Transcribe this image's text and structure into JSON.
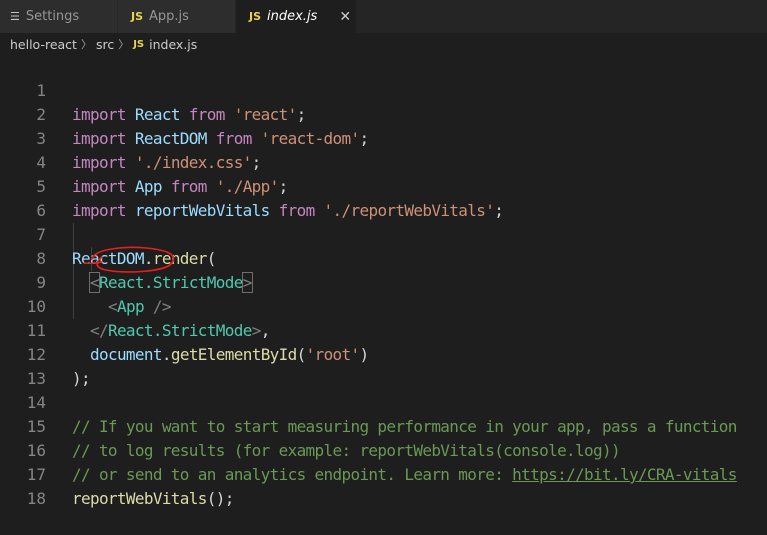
{
  "tabs": [
    {
      "icon": "menu-icon",
      "label": "Settings",
      "active": false
    },
    {
      "icon": "JS",
      "label": "App.js",
      "active": false
    },
    {
      "icon": "JS",
      "label": "index.js",
      "active": true,
      "close": "✕"
    }
  ],
  "breadcrumb": {
    "folder": "hello-react",
    "subfolder": "src",
    "file_icon": "JS",
    "file": "index.js",
    "sep": "〉"
  },
  "lines": {
    "n1": "1",
    "n2": "2",
    "n3": "3",
    "n4": "4",
    "n5": "5",
    "n6": "6",
    "n7": "7",
    "n8": "8",
    "n9": "9",
    "n10": "10",
    "n11": "11",
    "n12": "12",
    "n13": "13",
    "n14": "14",
    "n15": "15",
    "n16": "16",
    "n17": "17",
    "n18": "18"
  },
  "code": {
    "kw_import": "import",
    "kw_from": "from",
    "react": "React",
    "react_str": "'react'",
    "reactdom": "ReactDOM",
    "reactdom_str": "'react-dom'",
    "css_str": "'./index.css'",
    "app": "App",
    "app_str": "'./App'",
    "rwv": "reportWebVitals",
    "rwv_str": "'./reportWebVitals'",
    "semi": ";",
    "dot": ".",
    "render": "render",
    "open_paren": "(",
    "lt": "<",
    "gt": ">",
    "lt_slash": "</",
    "strict_mode": "React.StrictMode",
    "app_tag": "App",
    "self_close": " />",
    "comma": ",",
    "document": "document",
    "get_by_id": "getElementById",
    "root_str": "'root'",
    "close_paren": ")",
    "close_stmt": ");",
    "comment1": "// If you want to start measuring performance in your app, pass a function",
    "comment2": "// to log results (for example: reportWebVitals(console.log))",
    "comment3": "// or send to an analytics endpoint. Learn more: ",
    "comment3_url": "https://bit.ly/CRA-vitals",
    "call_end": "();"
  },
  "annotation_color": "#e8201a"
}
